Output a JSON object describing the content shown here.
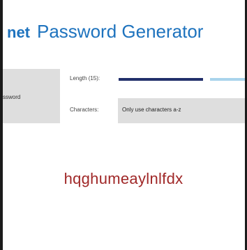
{
  "header": {
    "brand": "net",
    "title": "Password Generator"
  },
  "sidebar": {
    "tab_label": "ssword"
  },
  "options": {
    "length_label": "Length (15):",
    "length_value": 15,
    "characters_label": "Characters:",
    "characters_selected": "Only use characters a-z"
  },
  "result": {
    "password": "hqghumeaylnlfdx"
  },
  "colors": {
    "accent": "#1e73be",
    "password": "#a02828",
    "slider_fill": "#22306b",
    "slider_track": "#a9d4ec"
  }
}
